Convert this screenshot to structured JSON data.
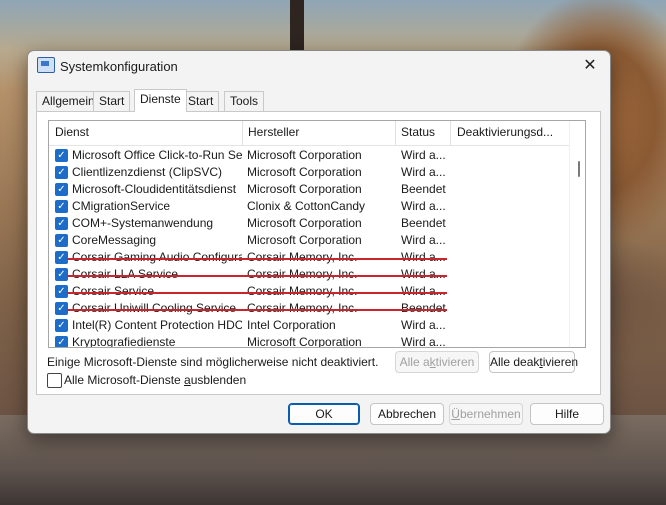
{
  "window": {
    "title": "Systemkonfiguration",
    "close_glyph": "✕"
  },
  "tabs": [
    {
      "label": "Allgemein",
      "active": false
    },
    {
      "label": "Start",
      "active": false
    },
    {
      "label": "Dienste",
      "active": true
    },
    {
      "label": "Start",
      "active": false
    },
    {
      "label": "Tools",
      "active": false
    }
  ],
  "columns": {
    "service": "Dienst",
    "manufacturer": "Hersteller",
    "status": "Status",
    "disabled_date": "Deaktivierungsd..."
  },
  "services": [
    {
      "name": "Microsoft Office Click-to-Run Ser...",
      "manufacturer": "Microsoft Corporation",
      "status": "Wird a...",
      "checked": true,
      "struck": false
    },
    {
      "name": "Clientlizenzdienst (ClipSVC)",
      "manufacturer": "Microsoft Corporation",
      "status": "Wird a...",
      "checked": true,
      "struck": false
    },
    {
      "name": "Microsoft-Cloudidentitätsdienst",
      "manufacturer": "Microsoft Corporation",
      "status": "Beendet",
      "checked": true,
      "struck": false
    },
    {
      "name": "CMigrationService",
      "manufacturer": "Clonix & CottonCandy",
      "status": "Wird a...",
      "checked": true,
      "struck": false
    },
    {
      "name": "COM+-Systemanwendung",
      "manufacturer": "Microsoft Corporation",
      "status": "Beendet",
      "checked": true,
      "struck": false
    },
    {
      "name": "CoreMessaging",
      "manufacturer": "Microsoft Corporation",
      "status": "Wird a...",
      "checked": true,
      "struck": false
    },
    {
      "name": "Corsair Gaming Audio Configurat...",
      "manufacturer": "Corsair Memory, Inc.",
      "status": "Wird a...",
      "checked": true,
      "struck": true
    },
    {
      "name": "Corsair LLA Service",
      "manufacturer": "Corsair Memory, Inc.",
      "status": "Wird a...",
      "checked": true,
      "struck": true
    },
    {
      "name": "Corsair Service",
      "manufacturer": "Corsair Memory, Inc.",
      "status": "Wird a...",
      "checked": true,
      "struck": true
    },
    {
      "name": "Corsair Uniwill Cooling Service",
      "manufacturer": "Corsair Memory, Inc.",
      "status": "Beendet",
      "checked": true,
      "struck": true
    },
    {
      "name": "Intel(R) Content Protection HDC...",
      "manufacturer": "Intel Corporation",
      "status": "Wird a...",
      "checked": true,
      "struck": false
    },
    {
      "name": "Kryptografiedienste",
      "manufacturer": "Microsoft Corporation",
      "status": "Wird a...",
      "checked": true,
      "struck": false
    }
  ],
  "notice": "Einige Microsoft-Dienste sind möglicherweise nicht deaktiviert.",
  "hide_ms": {
    "label_pre": "Alle Microsoft-Dienste ",
    "label_u": "a",
    "label_post": "usblenden",
    "checked": false
  },
  "buttons": {
    "enable_all": {
      "pre": "Alle a",
      "u": "k",
      "post": "tivieren",
      "enabled": false
    },
    "disable_all": {
      "pre": "Alle deak",
      "u": "t",
      "post": "ivieren",
      "enabled": true
    },
    "ok": "OK",
    "cancel": "Abbrechen",
    "apply": {
      "pre": "",
      "u": "Ü",
      "post": "bernehmen",
      "enabled": false
    },
    "help": "Hilfe"
  },
  "colors": {
    "accent": "#1d6cc8",
    "strike": "#c8252c"
  }
}
